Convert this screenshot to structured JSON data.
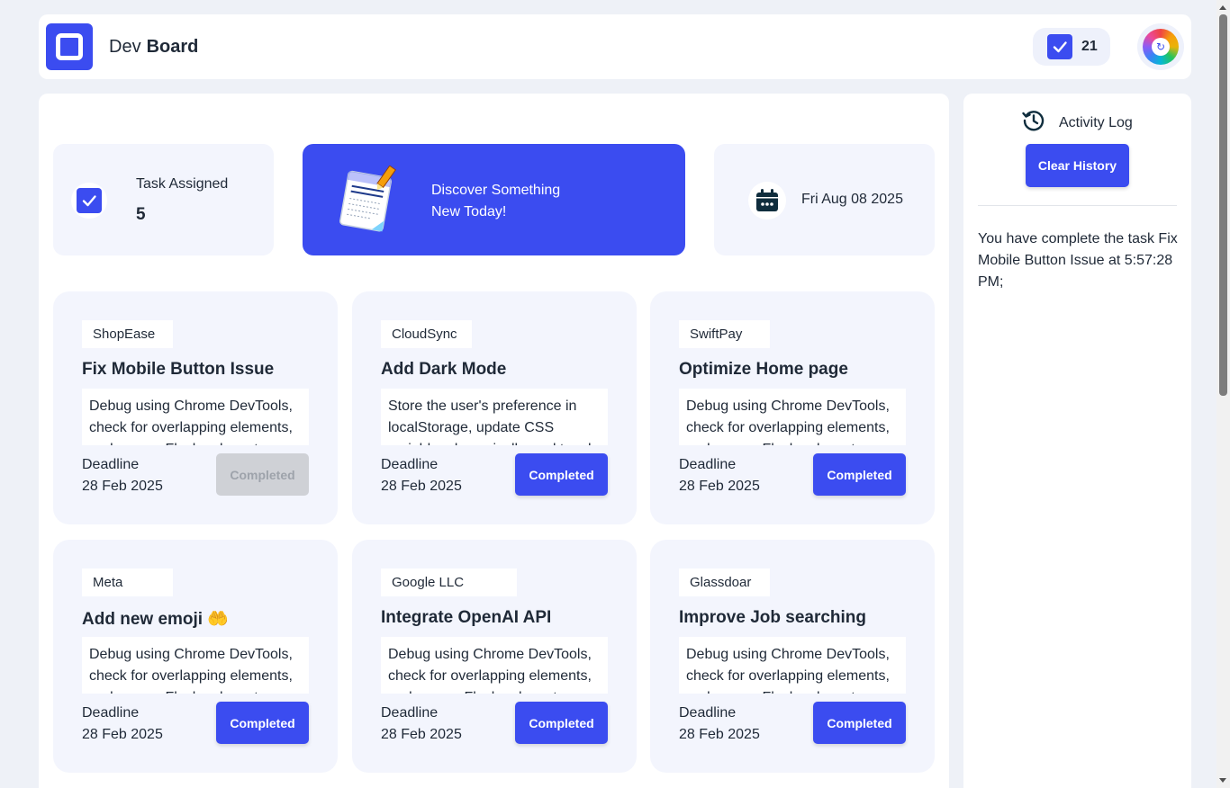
{
  "header": {
    "brand_part1": "Dev",
    "brand_part2": "Board",
    "completed_count": "21"
  },
  "stats": {
    "task_assigned_label": "Task Assigned",
    "task_assigned_value": "5",
    "banner_line1": "Discover Something",
    "banner_line2": "New Today!",
    "date": "Fri Aug 08 2025"
  },
  "tasks": [
    {
      "company": "ShopEase",
      "title": "Fix Mobile Button Issue",
      "description": "Debug using Chrome DevTools, check for overlapping elements, and ensure Flexbox layout",
      "deadline_label": "Deadline",
      "deadline": "28 Feb 2025",
      "button": "Completed",
      "done": true
    },
    {
      "company": "CloudSync",
      "title": "Add Dark Mode",
      "description": "Store the user's preference in localStorage, update CSS variables dynamically, and toggle",
      "deadline_label": "Deadline",
      "deadline": "28 Feb 2025",
      "button": "Completed",
      "done": false
    },
    {
      "company": "SwiftPay",
      "title": "Optimize Home page",
      "description": "Debug using Chrome DevTools, check for overlapping elements, and ensure Flexbox layout",
      "deadline_label": "Deadline",
      "deadline": "28 Feb 2025",
      "button": "Completed",
      "done": false
    },
    {
      "company": "Meta",
      "title": "Add new emoji 🤲",
      "description": "Debug using Chrome DevTools, check for overlapping elements, and ensure Flexbox layout",
      "deadline_label": "Deadline",
      "deadline": "28 Feb 2025",
      "button": "Completed",
      "done": false
    },
    {
      "company": "Google LLC",
      "title": "Integrate OpenAI API",
      "description": "Debug using Chrome DevTools, check for overlapping elements, and ensure Flexbox layout",
      "deadline_label": "Deadline",
      "deadline": "28 Feb 2025",
      "button": "Completed",
      "done": false
    },
    {
      "company": "Glassdoar",
      "title": "Improve Job searching",
      "description": "Debug using Chrome DevTools, check for overlapping elements, and ensure Flexbox layout",
      "deadline_label": "Deadline",
      "deadline": "28 Feb 2025",
      "button": "Completed",
      "done": false
    }
  ],
  "activity": {
    "title": "Activity Log",
    "clear_button": "Clear History",
    "entries": [
      "You have complete the task Fix Mobile Button Issue at 5:57:28 PM;"
    ]
  },
  "colors": {
    "accent": "#3b4cf0",
    "card_bg": "#f3f5fd",
    "page_bg": "#eef1f7",
    "disabled_button": "#cfd1d6"
  },
  "icons": {
    "logo": "devboard-logo-icon",
    "task_check": "checkbox-icon",
    "calendar": "calendar-icon",
    "history": "history-icon",
    "theme": "color-wheel-icon",
    "banner": "notepad-illustration"
  }
}
